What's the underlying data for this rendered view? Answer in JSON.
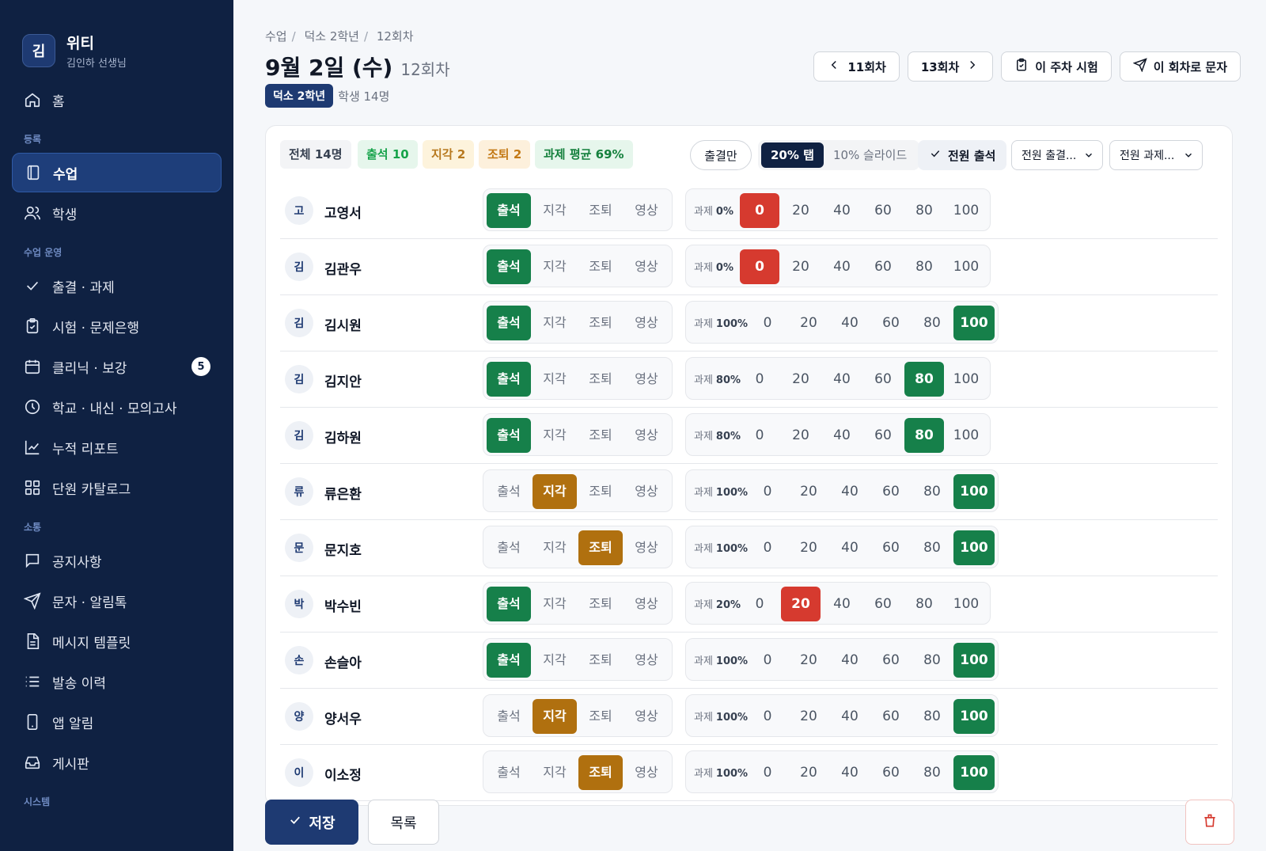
{
  "sidebar": {
    "brand": {
      "avatar": "김",
      "name": "위티",
      "sub": "김인하 선생님"
    },
    "home": "홈",
    "sections": {
      "register": "등록",
      "operation": "수업 운영",
      "comm": "소통",
      "system": "시스템"
    },
    "register_items": [
      {
        "label": "수업",
        "icon": "book-icon",
        "active": true
      },
      {
        "label": "학생",
        "icon": "users-icon"
      }
    ],
    "operation_items": [
      {
        "label": "출결 · 과제",
        "icon": "check-icon"
      },
      {
        "label": "시험 · 문제은행",
        "icon": "clipboard-icon"
      },
      {
        "label": "클리닉 · 보강",
        "icon": "calendar-icon",
        "badge": "5"
      },
      {
        "label": "학교 · 내신 · 모의고사",
        "icon": "clock-icon"
      },
      {
        "label": "누적 리포트",
        "icon": "chart-icon"
      },
      {
        "label": "단원 카탈로그",
        "icon": "grid-icon"
      }
    ],
    "comm_items": [
      {
        "label": "공지사항",
        "icon": "message-icon"
      },
      {
        "label": "문자 · 알림톡",
        "icon": "send-icon"
      },
      {
        "label": "메시지 템플릿",
        "icon": "file-icon"
      },
      {
        "label": "발송 이력",
        "icon": "list-icon"
      },
      {
        "label": "앱 알림",
        "icon": "phone-icon"
      },
      {
        "label": "게시판",
        "icon": "inbox-icon"
      }
    ]
  },
  "header": {
    "breadcrumb": [
      "수업",
      "덕소 2학년",
      "12회차"
    ],
    "title": "9월 2일 (수)",
    "session": "12회차",
    "class_badge": "덕소 2학년",
    "student_count": "학생 14명",
    "buttons": {
      "prev": "11회차",
      "next": "13회차",
      "exam": "이 주차 시험",
      "sms": "이 회차로 문자"
    }
  },
  "toolbar": {
    "total": "전체 14명",
    "attend": "출석 10",
    "late": "지각 2",
    "early": "조퇴 2",
    "hw_avg": "과제 평균 69%",
    "att_only": "출결만",
    "tab_on": "20% 탭",
    "tab_off": "10% 슬라이드",
    "all_attend": "전원 출석",
    "select_att": "전원 출결...",
    "select_hw": "전원 과제..."
  },
  "att_labels": [
    "출석",
    "지각",
    "조퇴",
    "영상"
  ],
  "hw_prefix": "과제",
  "hw_values": [
    "0",
    "20",
    "40",
    "60",
    "80",
    "100"
  ],
  "students": [
    {
      "initial": "고",
      "name": "고영서",
      "att": 0,
      "hw": 0,
      "hw_pct": "0%"
    },
    {
      "initial": "김",
      "name": "김관우",
      "att": 0,
      "hw": 0,
      "hw_pct": "0%"
    },
    {
      "initial": "김",
      "name": "김시원",
      "att": 0,
      "hw": 5,
      "hw_pct": "100%"
    },
    {
      "initial": "김",
      "name": "김지안",
      "att": 0,
      "hw": 4,
      "hw_pct": "80%"
    },
    {
      "initial": "김",
      "name": "김하원",
      "att": 0,
      "hw": 4,
      "hw_pct": "80%"
    },
    {
      "initial": "류",
      "name": "류은환",
      "att": 1,
      "hw": 5,
      "hw_pct": "100%"
    },
    {
      "initial": "문",
      "name": "문지호",
      "att": 2,
      "hw": 5,
      "hw_pct": "100%"
    },
    {
      "initial": "박",
      "name": "박수빈",
      "att": 0,
      "hw": 1,
      "hw_pct": "20%"
    },
    {
      "initial": "손",
      "name": "손슬아",
      "att": 0,
      "hw": 5,
      "hw_pct": "100%"
    },
    {
      "initial": "양",
      "name": "양서우",
      "att": 1,
      "hw": 5,
      "hw_pct": "100%"
    },
    {
      "initial": "이",
      "name": "이소정",
      "att": 2,
      "hw": 5,
      "hw_pct": "100%"
    }
  ],
  "footer": {
    "save": "저장",
    "list": "목록"
  },
  "colors": {
    "navy": "#0f2142",
    "accent": "#1e3a72",
    "green": "#16804a",
    "amber": "#b0700f",
    "red": "#d63a2f"
  }
}
